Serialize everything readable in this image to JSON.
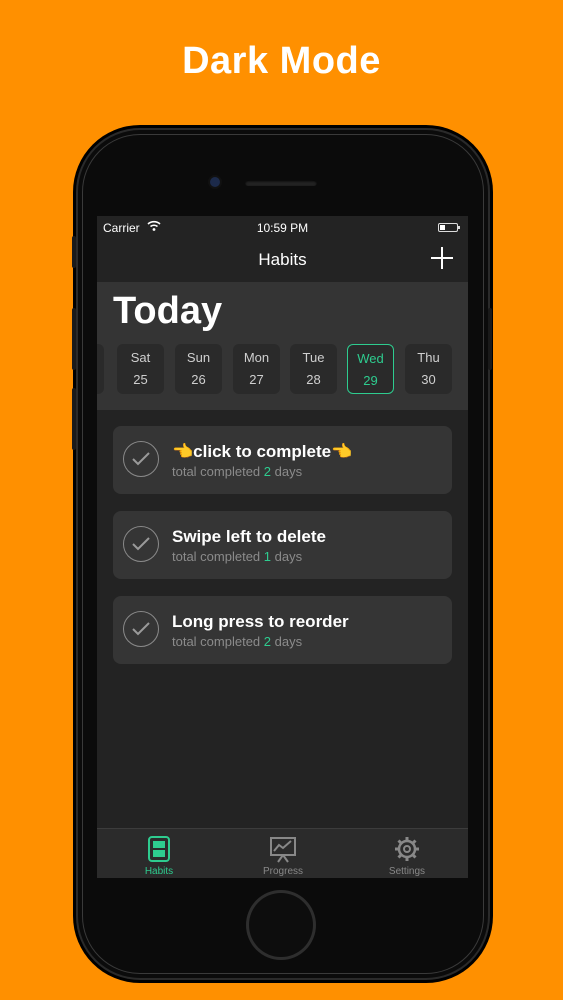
{
  "headline": "Dark Mode",
  "status_bar": {
    "carrier": "Carrier",
    "time": "10:59 PM"
  },
  "nav": {
    "title": "Habits"
  },
  "today": {
    "title": "Today",
    "days": [
      {
        "name": "Sat",
        "num": "25"
      },
      {
        "name": "Sun",
        "num": "26"
      },
      {
        "name": "Mon",
        "num": "27"
      },
      {
        "name": "Tue",
        "num": "28"
      },
      {
        "name": "Wed",
        "num": "29",
        "selected": true
      },
      {
        "name": "Thu",
        "num": "30"
      }
    ]
  },
  "habits": [
    {
      "title": "👈click to complete👈",
      "sub_prefix": "total completed ",
      "count": "2",
      "sub_suffix": " days"
    },
    {
      "title": "Swipe left to delete",
      "sub_prefix": "total completed ",
      "count": "1",
      "sub_suffix": " days"
    },
    {
      "title": "Long press to reorder",
      "sub_prefix": "total completed ",
      "count": "2",
      "sub_suffix": " days"
    }
  ],
  "tabs": [
    {
      "label": "Habits",
      "icon": "habits-icon",
      "active": true
    },
    {
      "label": "Progress",
      "icon": "progress-icon"
    },
    {
      "label": "Settings",
      "icon": "gear-icon"
    }
  ],
  "colors": {
    "background": "#FF9000",
    "accent": "#2ECC8F",
    "screen": "#232323"
  }
}
